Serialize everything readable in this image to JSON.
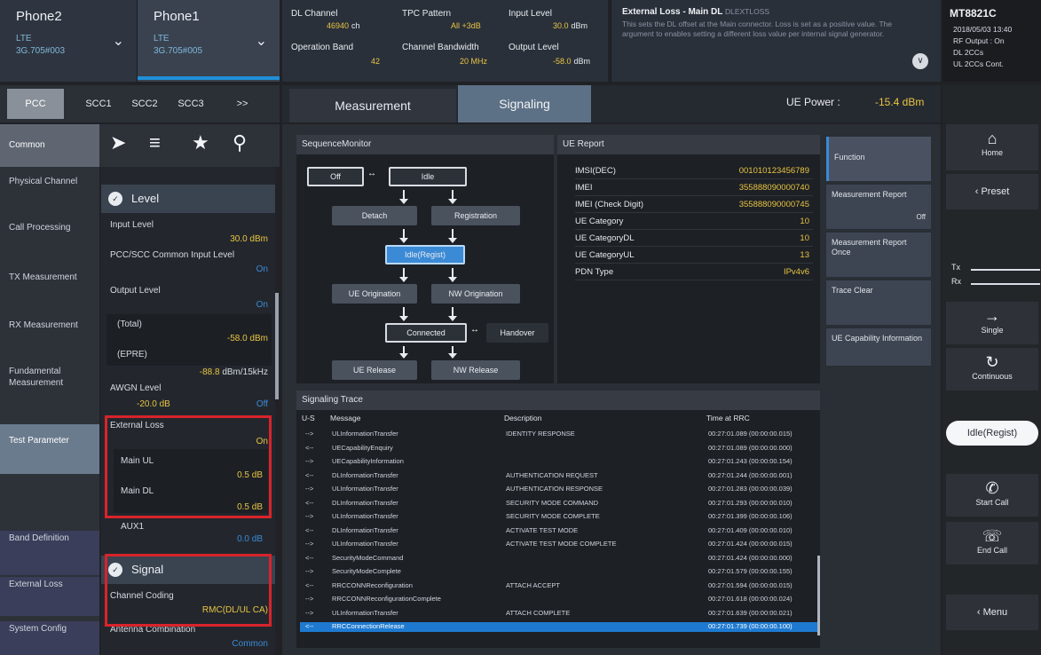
{
  "phones": {
    "phone2": {
      "name": "Phone2",
      "tech": "LTE",
      "id": "3G.705#003"
    },
    "phone1": {
      "name": "Phone1",
      "tech": "LTE",
      "id": "3G.705#005"
    }
  },
  "params": {
    "dl_channel_label": "DL Channel",
    "dl_channel_value": "46940",
    "dl_channel_unit": "ch",
    "tpc_label": "TPC Pattern",
    "tpc_value": "All +3dB",
    "input_level_label": "Input Level",
    "input_level_value": "30.0",
    "input_level_unit": "dBm",
    "op_band_label": "Operation Band",
    "op_band_value": "42",
    "ch_bw_label": "Channel Bandwidth",
    "ch_bw_value": "20 MHz",
    "output_level_label": "Output Level",
    "output_level_value": "-58.0",
    "output_level_unit": "dBm"
  },
  "info": {
    "title": "External Loss - Main DL",
    "command": "DLEXTLOSS",
    "body": "This sets the DL offset at the Main connector. Loss is set as a positive value. The argument to enables setting a different loss value per internal signal generator."
  },
  "device": {
    "model": "MT8821C",
    "datetime": "2018/05/03 13:40",
    "rf_output": "RF Output : On",
    "dl_ccs": "DL 2CCs",
    "ul_ccs": "UL 2CCs Cont."
  },
  "cc_tabs": [
    "PCC",
    "SCC1",
    "SCC2",
    "SCC3",
    ">>"
  ],
  "mode_tabs": {
    "measurement": "Measurement",
    "signaling": "Signaling"
  },
  "ue_power": {
    "label": "UE Power :",
    "value": "-15.4 dBm"
  },
  "left_nav": [
    "Common",
    "Physical Channel",
    "Call Processing",
    "TX Measurement",
    "RX Measurement",
    "Fundamental Measurement",
    "Test Parameter",
    "Band Definition",
    "External Loss",
    "System Config"
  ],
  "level": {
    "title": "Level",
    "input_level_label": "Input Level",
    "input_level_value": "30.0 dBm",
    "common_input_label": "PCC/SCC Common Input Level",
    "common_input_value": "On",
    "output_level_label": "Output Level",
    "output_level_value": "On",
    "total_label": "(Total)",
    "total_value": "-58.0 dBm",
    "epre_label": "(EPRE)",
    "epre_value": "-88.8",
    "epre_unit": "dBm/15kHz",
    "awgn_label": "AWGN Level",
    "awgn_value": "-20.0 dB",
    "awgn_state": "Off",
    "ext_loss_label": "External Loss",
    "ext_loss_value": "On",
    "main_ul_label": "Main UL",
    "main_ul_value": "0.5 dB",
    "main_dl_label": "Main DL",
    "main_dl_value": "0.5 dB",
    "aux1_label": "AUX1",
    "aux1_value": "0.0 dB"
  },
  "signal": {
    "title": "Signal",
    "channel_coding_label": "Channel Coding",
    "channel_coding_value": "RMC(DL/UL CA)",
    "antenna_label": "Antenna Combination",
    "antenna_value": "Common"
  },
  "sequence": {
    "title": "SequenceMonitor",
    "nodes": {
      "off": "Off",
      "idle": "Idle",
      "detach": "Detach",
      "registration": "Registration",
      "idle_regist": "Idle(Regist)",
      "ue_orig": "UE Origination",
      "nw_orig": "NW Origination",
      "connected": "Connected",
      "handover": "Handover",
      "ue_release": "UE Release",
      "nw_release": "NW Release"
    }
  },
  "ue_report": {
    "title": "UE Report",
    "rows": [
      {
        "label": "IMSI(DEC)",
        "value": "001010123456789"
      },
      {
        "label": "IMEI",
        "value": "355888090000740"
      },
      {
        "label": "IMEI (Check Digit)",
        "value": "355888090000745"
      },
      {
        "label": "UE Category",
        "value": "10"
      },
      {
        "label": "UE CategoryDL",
        "value": "10"
      },
      {
        "label": "UE CategoryUL",
        "value": "13"
      },
      {
        "label": "PDN Type",
        "value": "IPv4v6"
      }
    ]
  },
  "trace": {
    "title": "Signaling Trace",
    "headers": {
      "us": "U-S",
      "message": "Message",
      "description": "Description",
      "time": "Time at RRC"
    },
    "rows": [
      {
        "dir": "-->",
        "msg": "ULInformationTransfer",
        "desc": "IDENTITY RESPONSE",
        "time": "00:27:01.089 (00:00:00.015)"
      },
      {
        "dir": "<--",
        "msg": "UECapabilityEnquiry",
        "desc": "",
        "time": "00:27:01.089 (00:00:00.000)"
      },
      {
        "dir": "-->",
        "msg": "UECapabilityInformation",
        "desc": "",
        "time": "00:27:01.243 (00:00:00.154)"
      },
      {
        "dir": "<--",
        "msg": "DLInformationTransfer",
        "desc": "AUTHENTICATION REQUEST",
        "time": "00:27:01.244 (00:00:00.001)"
      },
      {
        "dir": "-->",
        "msg": "ULInformationTransfer",
        "desc": "AUTHENTICATION RESPONSE",
        "time": "00:27:01.283 (00:00:00.039)"
      },
      {
        "dir": "<--",
        "msg": "DLInformationTransfer",
        "desc": "SECURITY MODE COMMAND",
        "time": "00:27:01.293 (00:00:00.010)"
      },
      {
        "dir": "-->",
        "msg": "ULInformationTransfer",
        "desc": "SECURITY MODE COMPLETE",
        "time": "00:27:01.399 (00:00:00.106)"
      },
      {
        "dir": "<--",
        "msg": "DLInformationTransfer",
        "desc": "ACTIVATE TEST MODE",
        "time": "00:27:01.409 (00:00:00.010)"
      },
      {
        "dir": "-->",
        "msg": "ULInformationTransfer",
        "desc": "ACTIVATE TEST MODE COMPLETE",
        "time": "00:27:01.424 (00:00:00.015)"
      },
      {
        "dir": "<--",
        "msg": "SecurityModeCommand",
        "desc": "",
        "time": "00:27:01.424 (00:00:00.000)"
      },
      {
        "dir": "-->",
        "msg": "SecurityModeComplete",
        "desc": "",
        "time": "00:27:01.579 (00:00:00.155)"
      },
      {
        "dir": "<--",
        "msg": "RRCCONNReconfiguration",
        "desc": "ATTACH ACCEPT",
        "time": "00:27:01.594 (00:00:00.015)"
      },
      {
        "dir": "-->",
        "msg": "RRCCONNReconfigurationComplete",
        "desc": "",
        "time": "00:27:01.618 (00:00:00.024)"
      },
      {
        "dir": "-->",
        "msg": "ULInformationTransfer",
        "desc": "ATTACH COMPLETE",
        "time": "00:27:01.639 (00:00:00.021)"
      },
      {
        "dir": "<--",
        "msg": "RRCConnectionRelease",
        "desc": "",
        "time": "00:27:01.739 (00:00:00.100)"
      }
    ]
  },
  "functions": {
    "function": "Function",
    "meas_report": "Measurement Report",
    "meas_report_state": "Off",
    "meas_report_once": "Measurement Report Once",
    "trace_clear": "Trace Clear",
    "ue_cap": "UE Capability Information"
  },
  "right": {
    "home": "Home",
    "preset": "Preset",
    "tx": "Tx",
    "rx": "Rx",
    "single": "Single",
    "continuous": "Continuous",
    "status": "Idle(Regist)",
    "start_call": "Start Call",
    "end_call": "End Call",
    "menu": "Menu"
  }
}
